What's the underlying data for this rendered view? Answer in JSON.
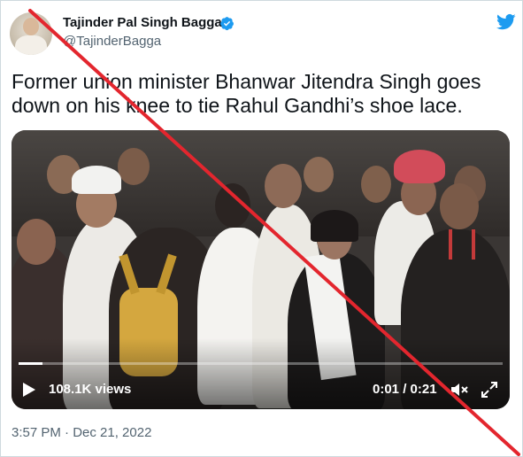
{
  "tweet": {
    "author_name": "Tajinder Pal Singh Bagga",
    "handle": "@TajinderBagga",
    "text": "Former union minister Bhanwar Jitendra Singh goes down on his knee to tie Rahul Gandhi’s shoe lace.",
    "timestamp": "3:57 PM · Dec 21, 2022",
    "verified": true
  },
  "video": {
    "views": "108.1K views",
    "time": "0:01 / 0:21",
    "progress": 0.05
  },
  "icons": {
    "verified": "verified-badge-icon",
    "logo": "twitter-bird-icon",
    "play": "play-icon",
    "mute": "mute-icon",
    "expand": "expand-icon"
  },
  "colors": {
    "twitter_blue": "#1d9bf0",
    "text": "#0f1419",
    "muted": "#536471",
    "cross_red": "#e3262e"
  }
}
